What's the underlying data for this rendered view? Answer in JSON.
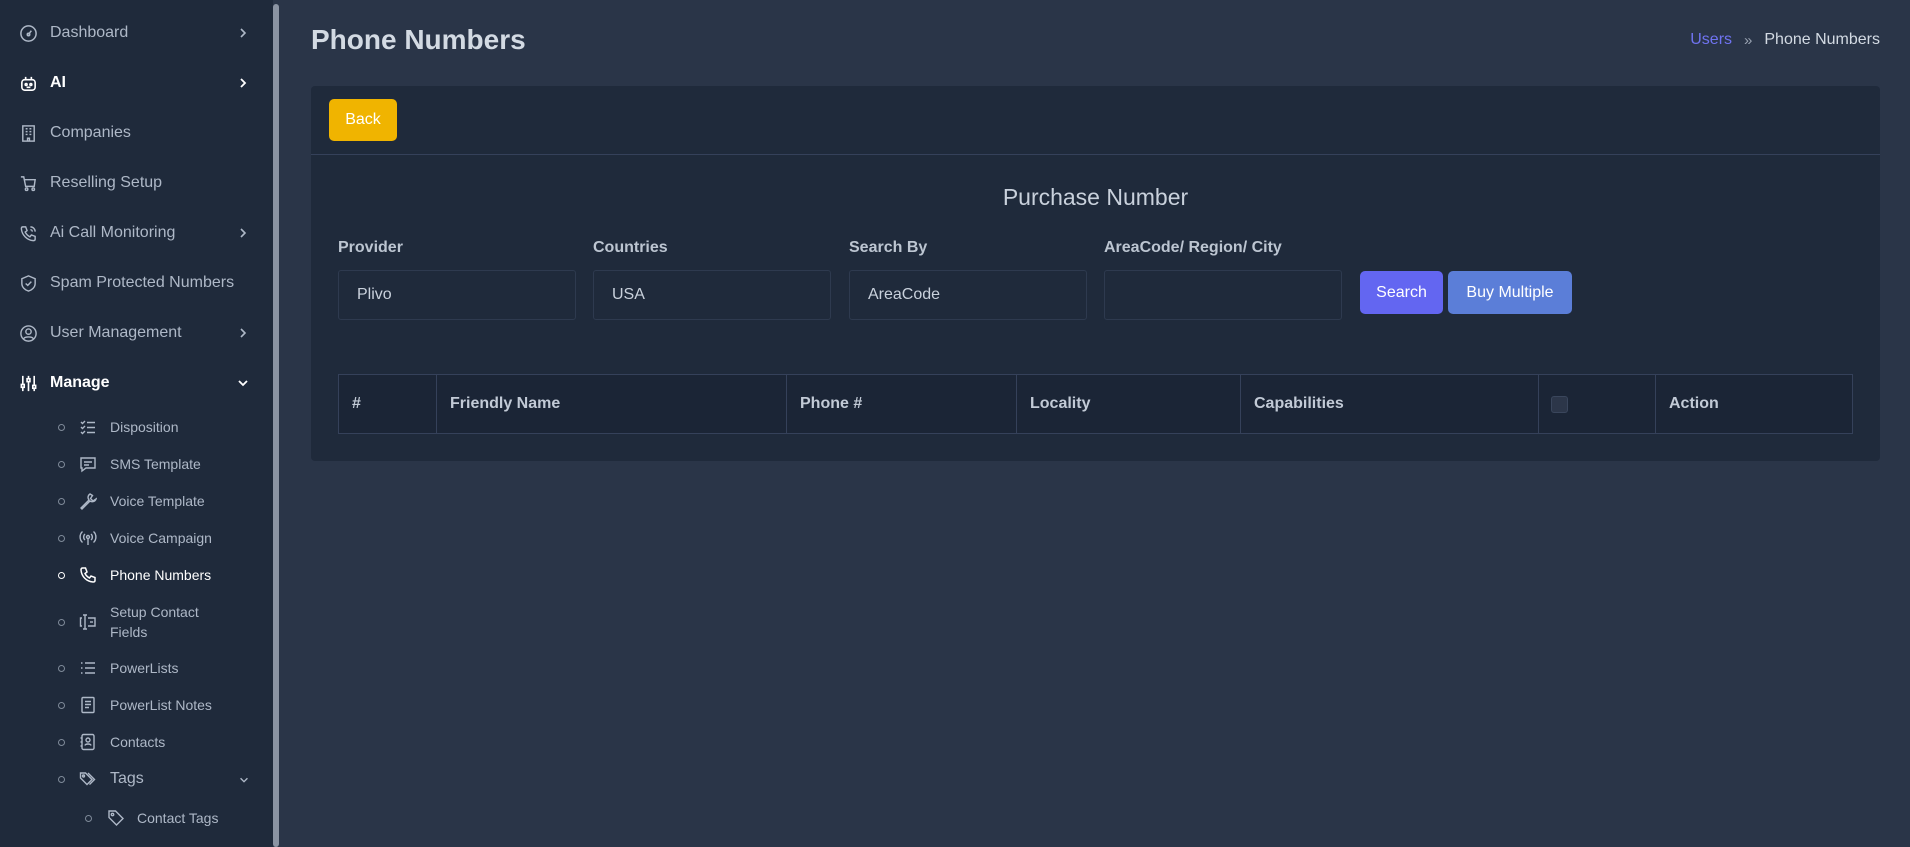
{
  "sidebar": {
    "items": [
      {
        "label": "Dashboard",
        "icon": "gauge-icon"
      },
      {
        "label": "AI",
        "icon": "robot-icon"
      },
      {
        "label": "Companies",
        "icon": "building-icon"
      },
      {
        "label": "Reselling Setup",
        "icon": "cart-icon"
      },
      {
        "label": "Ai Call Monitoring",
        "icon": "phone-call-icon"
      },
      {
        "label": "Spam Protected Numbers",
        "icon": "shield-check-icon"
      },
      {
        "label": "User Management",
        "icon": "user-circle-icon"
      },
      {
        "label": "Manage",
        "icon": "sliders-icon"
      }
    ],
    "sub_items": [
      {
        "label": "Disposition",
        "icon": "checklist-icon"
      },
      {
        "label": "SMS Template",
        "icon": "message-icon"
      },
      {
        "label": "Voice Template",
        "icon": "wrench-icon"
      },
      {
        "label": "Voice Campaign",
        "icon": "broadcast-icon"
      },
      {
        "label": "Phone Numbers",
        "icon": "phone-icon"
      },
      {
        "label": "Setup Contact Fields",
        "icon": "form-field-icon"
      },
      {
        "label": "PowerLists",
        "icon": "list-icon"
      },
      {
        "label": "PowerList Notes",
        "icon": "notes-icon"
      },
      {
        "label": "Contacts",
        "icon": "address-book-icon"
      },
      {
        "label": "Tags",
        "icon": "tags-icon"
      },
      {
        "label": "Contact Tags",
        "icon": "tag-icon"
      }
    ]
  },
  "header": {
    "title": "Phone Numbers",
    "breadcrumb_link": "Users",
    "breadcrumb_sep": "»",
    "breadcrumb_current": "Phone Numbers"
  },
  "card": {
    "back_label": "Back",
    "title": "Purchase Number",
    "fields": [
      {
        "label": "Provider",
        "value": "Plivo"
      },
      {
        "label": "Countries",
        "value": "USA"
      },
      {
        "label": "Search By",
        "value": "AreaCode"
      },
      {
        "label": "AreaCode/ Region/ City",
        "value": ""
      }
    ],
    "search_label": "Search",
    "buy_multiple_label": "Buy Multiple"
  },
  "table": {
    "columns": [
      "#",
      "Friendly Name",
      "Phone #",
      "Locality",
      "Capabilities",
      "",
      "Action"
    ]
  },
  "colors": {
    "sidebar_bg": "#1f2a3b",
    "page_bg": "#2a3548",
    "accent": "#6366f1",
    "back_button": "#f0b400",
    "buy_multiple": "#5b7ed8"
  }
}
